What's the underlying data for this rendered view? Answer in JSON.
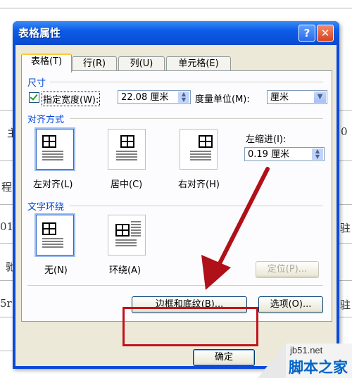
{
  "window": {
    "title": "表格属性"
  },
  "title_buttons": {
    "help": "?",
    "close": "✕"
  },
  "tabs": [
    {
      "label": "表格(T)",
      "active": true
    },
    {
      "label": "行(R)",
      "active": false
    },
    {
      "label": "列(U)",
      "active": false
    },
    {
      "label": "单元格(E)",
      "active": false
    }
  ],
  "size_section": {
    "label": "尺寸",
    "specify_width_label": "指定宽度(W):",
    "specify_width_checked": true,
    "width_value": "22.08 厘米",
    "unit_label": "度量单位(M):",
    "unit_value": "厘米"
  },
  "alignment_section": {
    "label": "对齐方式",
    "options": [
      {
        "label": "左对齐(L)",
        "selected": true
      },
      {
        "label": "居中(C)",
        "selected": false
      },
      {
        "label": "右对齐(H)",
        "selected": false
      }
    ],
    "indent_label": "左缩进(I):",
    "indent_value": "0.19 厘米"
  },
  "wrap_section": {
    "label": "文字环绕",
    "options": [
      {
        "label": "无(N)",
        "selected": true
      },
      {
        "label": "环绕(A)",
        "selected": false
      }
    ],
    "position_button": "定位(P)..."
  },
  "buttons": {
    "borders_shading": "边框和底纹(B)...",
    "options": "选项(O)...",
    "ok": "确定"
  },
  "watermark": {
    "url": "jb51.net",
    "name": "脚本之家"
  },
  "background_fragments": [
    "主",
    "0",
    "程",
    "01",
    "驰",
    "驻",
    "5r",
    "驻"
  ],
  "annotation_color": "#c0141c"
}
